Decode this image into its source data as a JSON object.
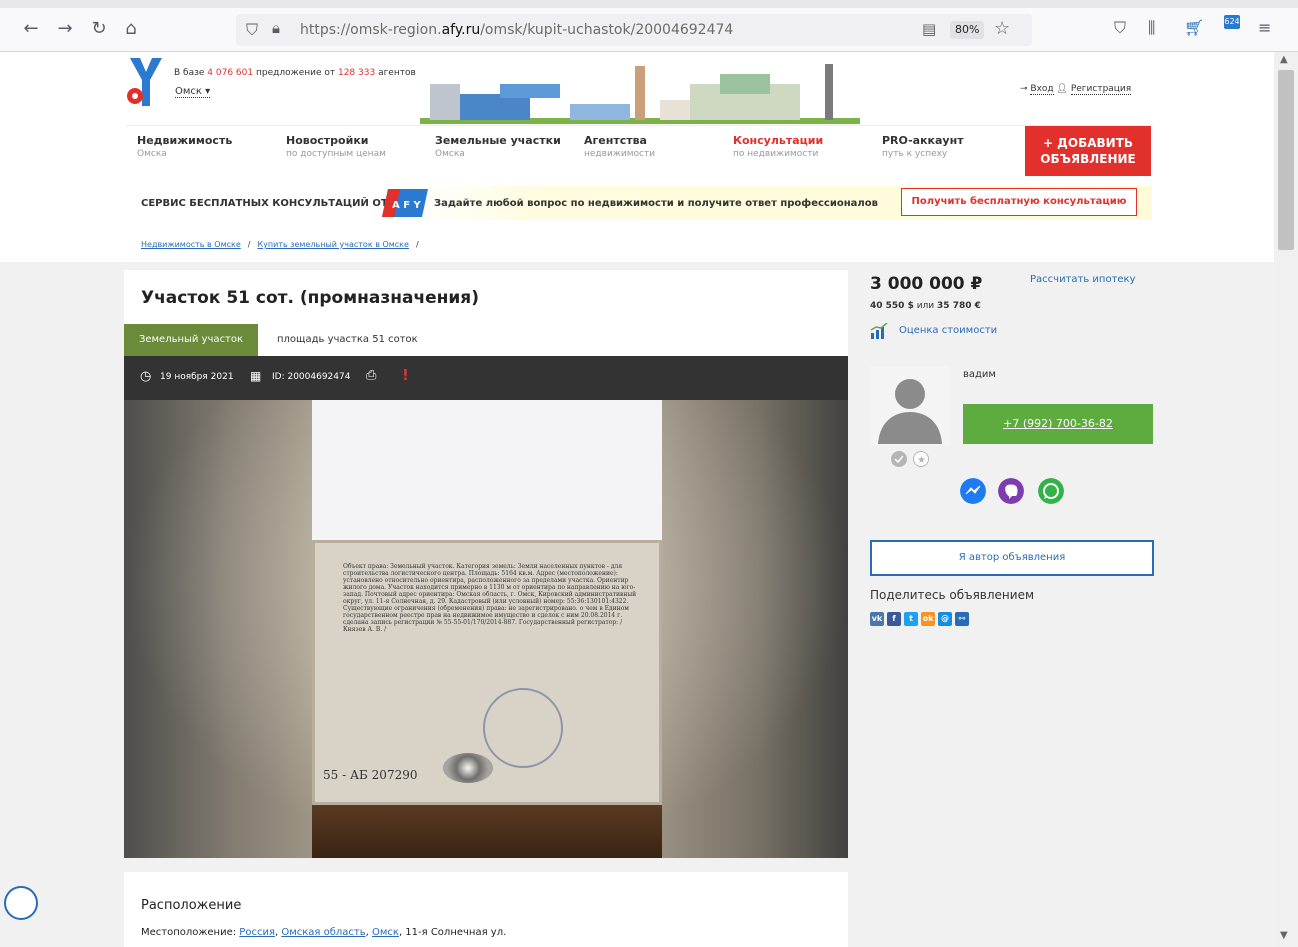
{
  "browser": {
    "url_prefix": "https://omsk-region.",
    "url_domain": "afy.ru",
    "url_path": "/omsk/kupit-uchastok/20004692474",
    "zoom": "80%",
    "badge_count": "624"
  },
  "header": {
    "base_prefix": "В базе ",
    "offers_count": "4 076 601",
    "base_mid": " предложение от ",
    "agents_count": "128 333",
    "base_suffix": " агентов",
    "city": "Омск",
    "login": "Вход",
    "register": "Регистрация"
  },
  "menu": [
    {
      "title": "Недвижимость",
      "sub": "Омска"
    },
    {
      "title": "Новостройки",
      "sub": "по доступным ценам"
    },
    {
      "title": "Земельные участки",
      "sub": "Омска"
    },
    {
      "title": "Агентства",
      "sub": "недвижимости"
    },
    {
      "title": "Консультации",
      "sub": "по недвижимости"
    },
    {
      "title": "PRO-аккаунт",
      "sub": "путь к успеху"
    }
  ],
  "add_button": {
    "line1": "+ ДОБАВИТЬ",
    "line2": "ОБЪЯВЛЕНИЕ"
  },
  "consult": {
    "label": "СЕРВИС БЕСПЛАТНЫХ КОНСУЛЬТАЦИЙ ОТ",
    "question": "Задайте любой вопрос по недвижимости и получите ответ профессионалов",
    "button": "Получить бесплатную консультацию"
  },
  "breadcrumb": [
    "Недвижимость в Омске",
    "Купить земельный участок в Омске"
  ],
  "listing": {
    "title": "Участок 51 сот. (промназначения)",
    "tab_active": "Земельный участок",
    "tab_area": "площадь участка 51 соток",
    "date": "19 ноября 2021",
    "id": "ID: 20004692474"
  },
  "document": {
    "text": "Объект права: Земельный участок. Категория земель: Земли населенных пунктов - для строительства логистического центра. Площадь: 5164 кв.м. Адрес (местоположение): установлено относительно ориентира, расположенного за пределами участка. Ориентир жилого дома. Участок находится примерно в 1130 м от ориентира по направлению на юго-запад. Почтовый адрес ориентира: Омская область, г. Омск, Кировский административный округ, ул. 11-я Солнечная, д. 29. Кадастровый (или условный) номер: 55:36:130101:4322. Существующие ограничения (обременения) права: не зарегистрировано. о чем в Едином государственном реестре прав на недвижимое имущество и сделок с ним 20.08.2014 г. сделана запись регистрации № 55-55-01/170/2014-887. Государственный регистратор: / Князев А. В. /",
    "number": "55 - АБ  207290"
  },
  "location": {
    "heading": "Расположение",
    "label": "Местоположение: ",
    "country": "Россия",
    "region": "Омская область",
    "city": "Омск",
    "street": ", 11-я Солнечная ул."
  },
  "sidebar": {
    "price": "3 000 000 ₽",
    "mortgage": "Рассчитать ипотеку",
    "usd": "40 550 $",
    "or": " или ",
    "eur": "35 780 €",
    "estimate": "Оценка стоимости",
    "seller": "вадим",
    "phone": "+7 (992) 700-36-82",
    "author": "Я автор объявления",
    "share": "Поделитесь объявлением"
  },
  "colors": {
    "brand_red": "#e2312d",
    "link_blue": "#2a6bb8",
    "phone_green": "#5eab3f",
    "tab_green": "#6b8b3a"
  }
}
